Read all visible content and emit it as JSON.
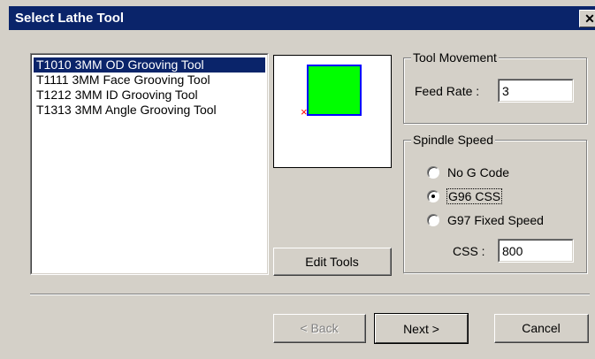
{
  "window": {
    "title": "Select Lathe Tool",
    "close_glyph": "✕"
  },
  "tool_list": {
    "items": [
      {
        "label": "T1010 3MM OD Grooving Tool",
        "selected": true
      },
      {
        "label": "T1111 3MM Face Grooving Tool",
        "selected": false
      },
      {
        "label": "T1212 3MM ID Grooving Tool",
        "selected": false
      },
      {
        "label": "T1313 3MM Angle Grooving Tool",
        "selected": false
      }
    ]
  },
  "preview": {
    "shape_color": "#00ff00",
    "outline_color": "#0000ff",
    "marker_color": "#ff0000",
    "marker_glyph": "×"
  },
  "buttons": {
    "edit_tools": "Edit Tools",
    "back": "< Back",
    "next": "Next >",
    "cancel": "Cancel"
  },
  "tool_movement": {
    "title": "Tool Movement",
    "feed_rate_label": "Feed Rate :",
    "feed_rate_value": "3"
  },
  "spindle_speed": {
    "title": "Spindle Speed",
    "options": [
      {
        "label": "No G Code",
        "checked": false
      },
      {
        "label": "G96 CSS",
        "checked": true
      },
      {
        "label": "G97 Fixed Speed",
        "checked": false
      }
    ],
    "css_label": "CSS :",
    "css_value": "800"
  },
  "colors": {
    "titlebar": "#0a246a",
    "selection": "#0a246a",
    "dialog_face": "#d4d0c8"
  }
}
